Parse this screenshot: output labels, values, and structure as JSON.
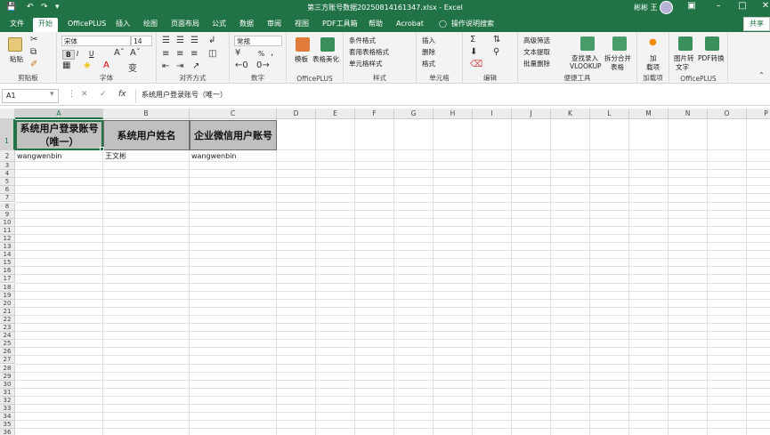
{
  "titlebar": {
    "title": "第三方账号数据20250814161347.xlsx  -  Excel",
    "user": "彬彬 王",
    "save_icon": "save-icon",
    "undo_icon": "undo-icon",
    "redo_icon": "redo-icon",
    "quick_icon": "customize-quick-access-icon"
  },
  "tabs": [
    "文件",
    "开始",
    "OfficePLUS",
    "插入",
    "绘图",
    "页面布局",
    "公式",
    "数据",
    "审阅",
    "视图",
    "PDF工具箱",
    "帮助",
    "Acrobat",
    "操作说明搜索"
  ],
  "share_label": "共享",
  "ribbon": {
    "clipboard": {
      "paste": "粘贴",
      "label": "剪贴板"
    },
    "font": {
      "name": "宋体",
      "size": "14",
      "bold": "B",
      "italic": "I",
      "underline": "U",
      "label": "字体"
    },
    "align": {
      "label": "对齐方式"
    },
    "number": {
      "format": "常规",
      "percent": "%",
      "label": "数字"
    },
    "officeplus": {
      "template": "模板",
      "beautify": "表格美化",
      "label": "OfficePLUS"
    },
    "styles": {
      "cond": "条件格式",
      "table": "套用表格格式",
      "cell": "单元格样式",
      "label": "样式"
    },
    "cells": {
      "insert": "插入",
      "delete": "删除",
      "format": "格式",
      "label": "单元格"
    },
    "edit": {
      "label": "编辑"
    },
    "tools": {
      "filter": "高级筛选",
      "extract": "文本提取",
      "batchdel": "批量删除",
      "vlookup1": "查找录入",
      "vlookup2": "VLOOKUP",
      "split1": "拆分合并",
      "split2": "表格",
      "label": "便捷工具"
    },
    "addins": {
      "add1": "加",
      "add2": "载项",
      "label": "加载项"
    },
    "op2": {
      "img1": "图片转",
      "img2": "文字",
      "pdf1": "PDF转换",
      "label": "OfficePLUS"
    }
  },
  "formula": {
    "name_box": "A1",
    "content": "系统用户登录账号（唯一）"
  },
  "columns": [
    "A",
    "B",
    "C",
    "D",
    "E",
    "F",
    "G",
    "H",
    "I",
    "J",
    "K",
    "L",
    "M",
    "N",
    "O",
    "P"
  ],
  "rows": [
    "1",
    "2",
    "3",
    "4",
    "5",
    "6",
    "7",
    "8",
    "9",
    "10",
    "11",
    "12",
    "13",
    "14",
    "15",
    "16",
    "17",
    "18",
    "19",
    "20",
    "21",
    "22",
    "23",
    "24",
    "25",
    "26",
    "27",
    "28",
    "29",
    "30",
    "31",
    "32",
    "33",
    "34",
    "35",
    "36"
  ],
  "sheet": {
    "headers": [
      "系统用户登录账号（唯一）",
      "系统用户姓名",
      "企业微信用户账号"
    ],
    "row2": [
      "wangwenbin",
      "王文彬",
      "wangwenbin"
    ]
  }
}
